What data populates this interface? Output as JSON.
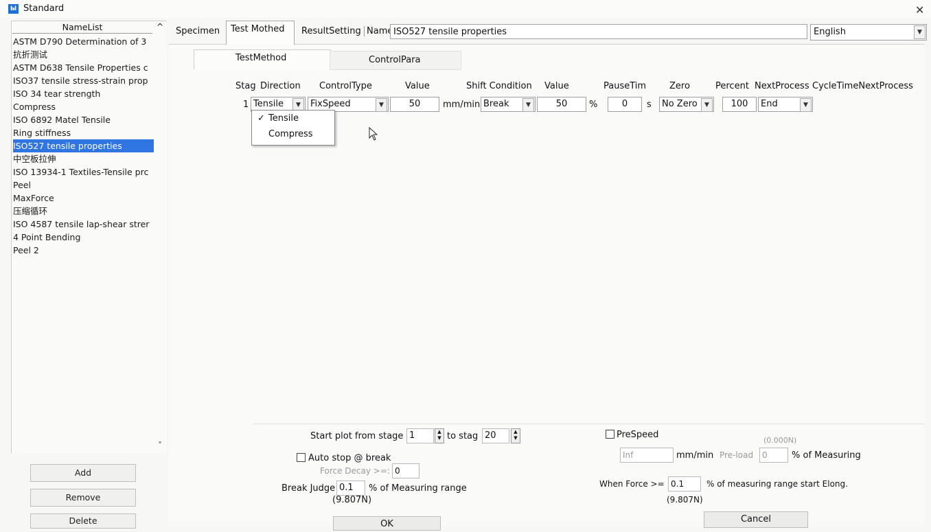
{
  "window": {
    "title": "Standard",
    "app_icon": "Ы",
    "close": "✕"
  },
  "namelist": {
    "header": "NameList",
    "items": [
      "ASTM D790 Determination of 3",
      "抗折测试",
      "ASTM D638 Tensile Properties c",
      "ISO37 tensile stress-strain prop",
      "ISO 34 tear strength",
      "Compress",
      "ISO 6892  Matel Tensile",
      "Ring stiffness",
      "ISO527 tensile properties",
      "中空板拉伸",
      "ISO 13934-1 Textiles-Tensile prc",
      "Peel",
      "MaxForce",
      "压缩循环",
      "ISO 4587 tensile lap-shear strer",
      "4 Point Bending",
      "Peel 2"
    ],
    "selected_index": 8
  },
  "left_buttons": {
    "add": "Add",
    "remove": "Remove",
    "delete": "Delete"
  },
  "tabs": {
    "specimen": "Specimen",
    "test_mothed": "Test Mothed",
    "result_setting": "ResultSetting"
  },
  "name": {
    "label": "Name",
    "value": "ISO527 tensile properties"
  },
  "language": {
    "value": "English"
  },
  "sub_tabs": {
    "test_method": "TestMethod",
    "control_para": "ControlPara"
  },
  "stage_table": {
    "headers": [
      "Stag",
      "Direction",
      "ControlType",
      "Value",
      "Shift Condition",
      "Value",
      "PauseTim",
      "Zero",
      "Percent",
      "NextProcess",
      "CycleTimeNextProcess"
    ],
    "row": {
      "stage": "1",
      "direction": "Tensile",
      "control_type": "FixSpeed",
      "value": "50",
      "value_unit": "mm/min",
      "shift_condition": "Break",
      "shift_value": "50",
      "shift_unit": "%",
      "pause_time": "0",
      "pause_unit": "s",
      "zero": "No Zero",
      "percent": "100",
      "next_process": "End"
    }
  },
  "direction_dropdown": {
    "options": [
      "Tensile",
      "Compress"
    ],
    "checked": "✓"
  },
  "bottom": {
    "start_plot_label": "Start plot from stage",
    "start_plot_value": "1",
    "to_stage_label": "to stag",
    "to_stage_value": "20",
    "auto_stop_label": "Auto stop @ break",
    "force_decay_label": "Force Decay >=:",
    "force_decay_value": "0",
    "break_judge_label": "Break Judge",
    "break_judge_value": "0.1",
    "break_judge_unit": "% of Measuring range",
    "break_judge_force": "(9.807N)",
    "prespeed_label": "PreSpeed",
    "prespeed_value": "Inf",
    "prespeed_unit": "mm/min",
    "preload_label": "Pre-load",
    "preload_value": "0",
    "preload_unit": "% of Measuring",
    "preload_force": "(0.000N)",
    "when_force_label": "When Force >=",
    "when_force_value": "0.1",
    "when_force_unit": "% of measuring range start Elong.",
    "when_force_force": "(9.807N)",
    "ok": "OK",
    "cancel": "Cancel"
  }
}
